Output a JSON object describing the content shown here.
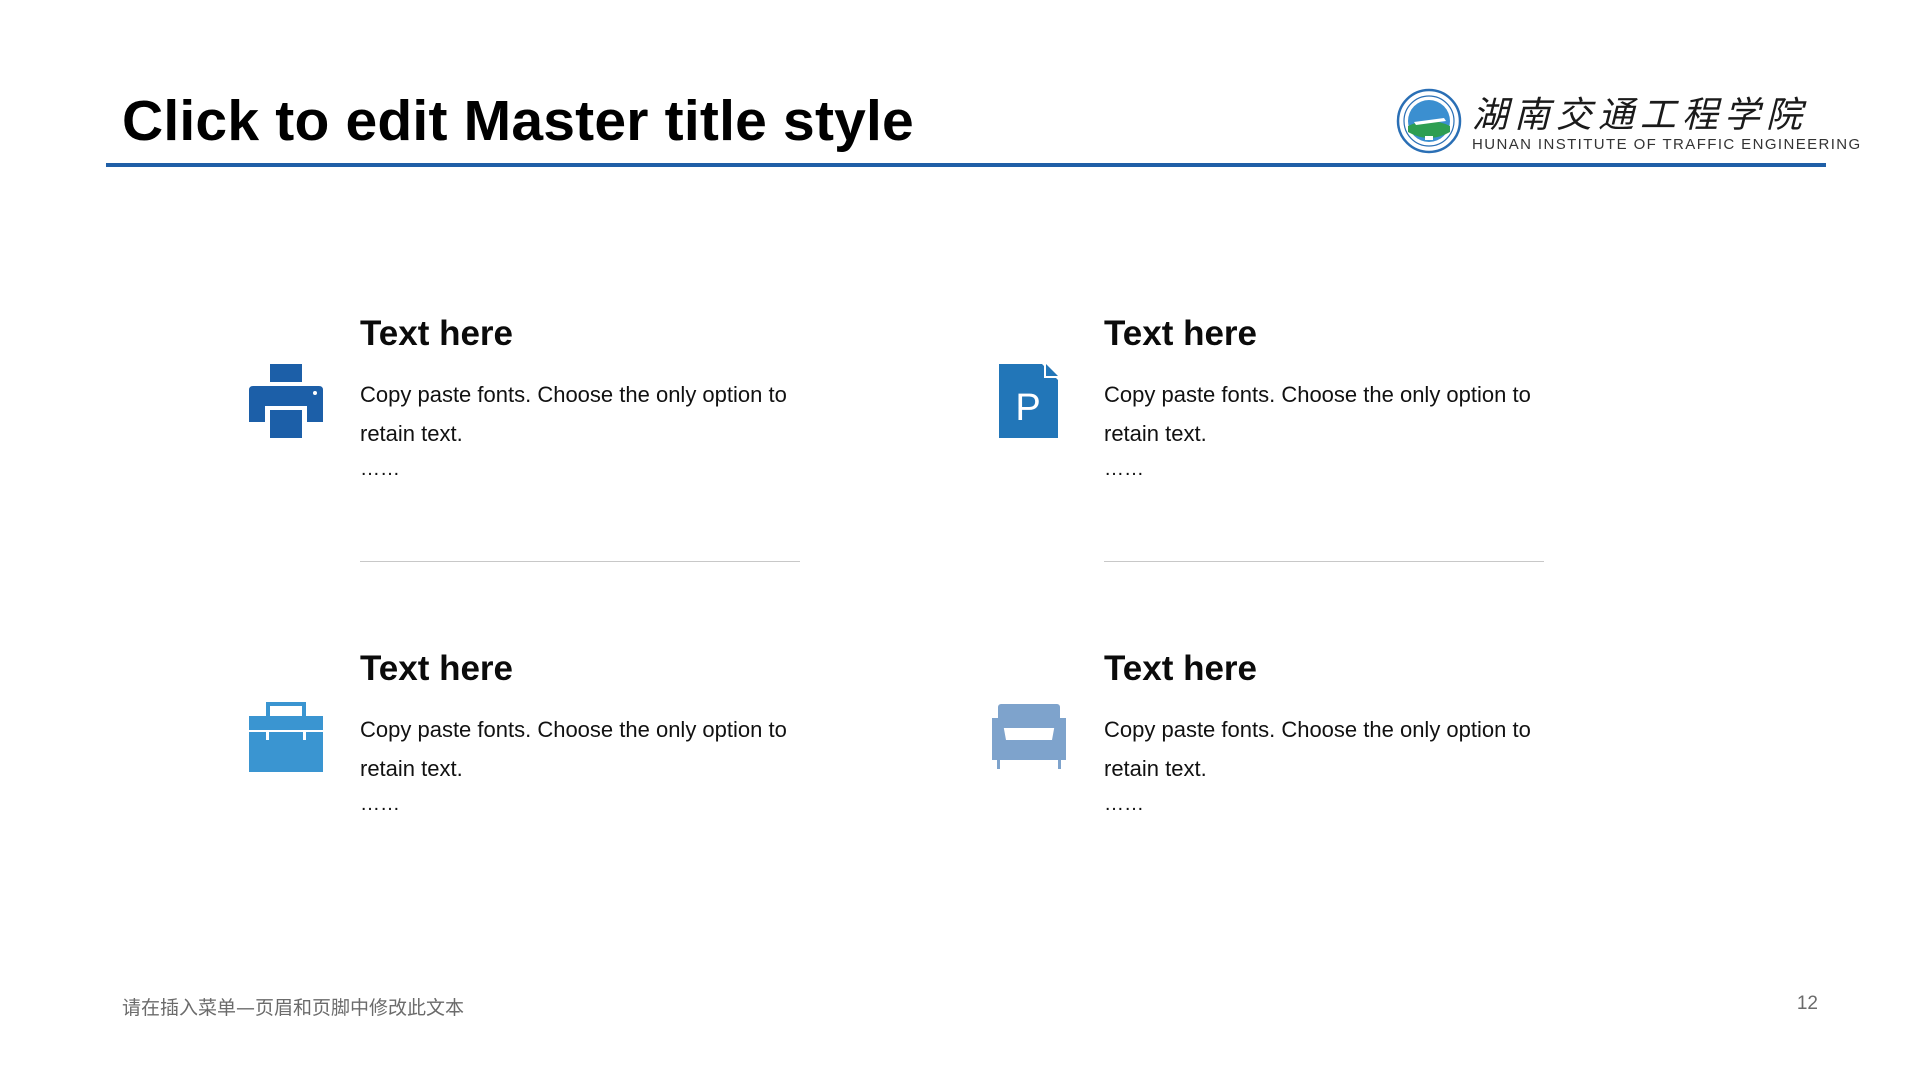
{
  "slide": {
    "title": "Click to edit Master title style",
    "footer_text": "请在插入菜单—页眉和页脚中修改此文本",
    "page_number": "12"
  },
  "logo": {
    "name_cn": "湖南交通工程学院",
    "name_en": "HUNAN INSTITUTE OF TRAFFIC ENGINEERING"
  },
  "colors": {
    "rule": "#1f5fa7",
    "icon_dark_blue": "#1c5fa8",
    "icon_mid_blue": "#2276b8",
    "icon_light_blue": "#3a95d1",
    "icon_slate_blue": "#7ea3cc"
  },
  "cards": [
    {
      "heading": "Text here",
      "body": "Copy paste fonts. Choose the only option to retain text.",
      "ellipsis": "……",
      "icon": "printer-icon"
    },
    {
      "heading": "Text here",
      "body": "Copy paste fonts. Choose the only option to retain text.",
      "ellipsis": "……",
      "icon": "document-p-icon"
    },
    {
      "heading": "Text here",
      "body": "Copy paste fonts. Choose the only option to retain text.",
      "ellipsis": "……",
      "icon": "toolbox-icon"
    },
    {
      "heading": "Text here",
      "body": "Copy paste fonts. Choose the only option to retain text.",
      "ellipsis": "……",
      "icon": "sofa-icon"
    }
  ],
  "icon_glyphs": {
    "document_letter": "P"
  }
}
